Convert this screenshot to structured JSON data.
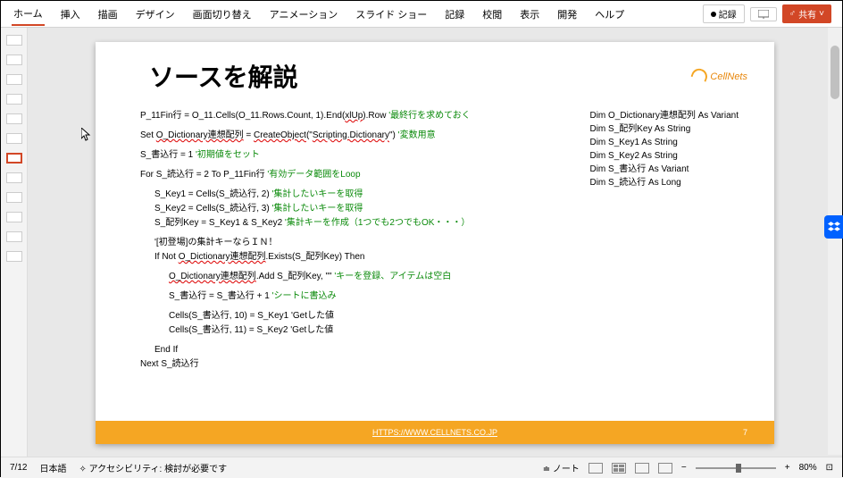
{
  "ribbon": {
    "tabs": [
      "ホーム",
      "挿入",
      "描画",
      "デザイン",
      "画面切り替え",
      "アニメーション",
      "スライド ショー",
      "記録",
      "校閲",
      "表示",
      "開発",
      "ヘルプ"
    ],
    "record": "記録",
    "share": "共有"
  },
  "slide": {
    "title": "ソースを解説",
    "logo": "CellNets",
    "footer_url": "HTTPS://WWW.CELLNETS.CO.JP",
    "page_num": "7"
  },
  "code": {
    "l1a": "P_11Fin行 = O_11.Cells(O_11.Rows.Count, 1).End(",
    "l1b": "xlUp",
    "l1c": ").Row ",
    "l1g": "'最終行を求めておく",
    "l2a": "Set ",
    "l2b": "O_Dictionary連想配列",
    "l2c": " = ",
    "l2d": "CreateObject",
    "l2e": "(\"",
    "l2f": "Scripting.Dictionary",
    "l2g": "\") ",
    "l2h": "'変数用意",
    "l3a": "S_書込行 = 1 ",
    "l3g": "'初期値をセット",
    "l4a": "For S_読込行 = 2 To P_11Fin行 ",
    "l4g": "'有効データ範囲をLoop",
    "l5a": "S_Key1 = Cells(S_読込行, 2) ",
    "l5g": "'集計したいキーを取得",
    "l6a": "S_Key2 = Cells(S_読込行, 3) ",
    "l6g": "'集計したいキーを取得",
    "l7a": "S_配列Key = S_Key1 & S_Key2 ",
    "l7g": "'集計キーを作成（1つでも2つでもOK・・・）",
    "l8a": "'[初登場]の集計キーならＩＮ！",
    "l9a": "If Not ",
    "l9b": "O_Dictionary連想配列",
    "l9c": ".Exists(S_配列Key) Then",
    "l10a": "O_Dictionary連想配列",
    "l10b": ".Add S_配列Key, \"\"    ",
    "l10g": "'キーを登録、アイテムは空白",
    "l11a": "S_書込行 = S_書込行 + 1 ",
    "l11g": "'シートに書込み",
    "l12a": "Cells(S_書込行, 10) = S_Key1       'Getした値",
    "l13a": "Cells(S_書込行, 11) = S_Key2       'Getした値",
    "l14a": "End If",
    "l15a": "Next S_読込行"
  },
  "dims": {
    "d1": "Dim O_Dictionary連想配列 As Variant",
    "d2": "Dim S_配列Key As String",
    "d3": "Dim S_Key1 As String",
    "d4": "Dim S_Key2 As String",
    "d5": "Dim S_書込行 As Variant",
    "d6": "Dim S_読込行 As Long"
  },
  "status": {
    "page": "7/12",
    "lang": "日本語",
    "access_label": "アクセシビリティ: 検討が必要です",
    "notes": "ノート",
    "zoom": "80%"
  }
}
